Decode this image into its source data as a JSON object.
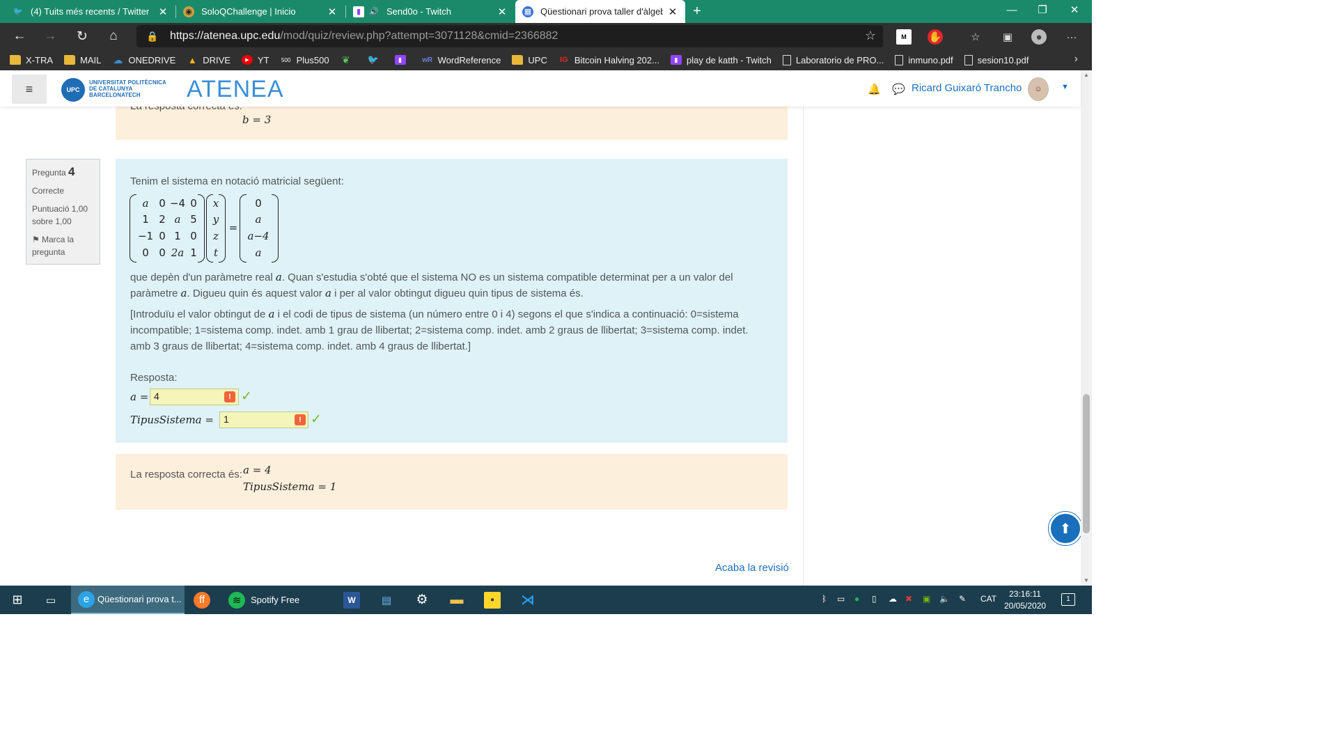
{
  "browser": {
    "tabs": [
      {
        "title": "(4) Tuits més recents / Twitter",
        "icon": "twitter-icon"
      },
      {
        "title": "SoloQChallenge | Inicio",
        "icon": "soloq-icon"
      },
      {
        "title": "Send0o - Twitch",
        "icon": "twitch-icon"
      },
      {
        "title": "Qüestionari prova taller d'àlgebr",
        "icon": "atenea-icon"
      }
    ],
    "url_host": "https://atenea.upc.edu",
    "url_path": "/mod/quiz/review.php?attempt=3071128&cmid=2366882",
    "bookmarks": [
      "X-TRA",
      "MAIL",
      "ONEDRIVE",
      "DRIVE",
      "YT",
      "Plus500",
      "",
      "",
      "",
      "WordReference",
      "UPC",
      "Bitcoin Halving 202...",
      "play de katth - Twitch",
      "Laboratorio de PRO...",
      "inmuno.pdf",
      "sesion10.pdf"
    ]
  },
  "site": {
    "upc_line1": "UNIVERSITAT POLITÈCNICA",
    "upc_line2": "DE CATALUNYA",
    "upc_line3": "BARCELONATECH",
    "upc_badge": "UPC",
    "brand": "ATENEA",
    "user_name": "Ricard Guixaró Trancho"
  },
  "prev_answer": {
    "label": "La resposta correcta és:",
    "line": "b = 3"
  },
  "question": {
    "label": "Pregunta",
    "number": "4",
    "state": "Correcte",
    "score": "Puntuació 1,00 sobre 1,00",
    "flag": "Marca la pregunta",
    "intro": "Tenim el sistema en notació matricial següent:",
    "matrix": [
      [
        "a",
        "0",
        "−4",
        "0"
      ],
      [
        "1",
        "2",
        "a",
        "5"
      ],
      [
        "−1",
        "0",
        "1",
        "0"
      ],
      [
        "0",
        "0",
        "2a",
        "1"
      ]
    ],
    "vars": [
      "x",
      "y",
      "z",
      "t"
    ],
    "rhs": [
      "0",
      "a",
      "a−4",
      "a"
    ],
    "para1_a": "que depèn d'un paràmetre real",
    "para1_b": ". Quan s'estudia s'obté que el sistema NO es un sistema compatible determinat per a un valor del paràmetre",
    "para1_c": ". Digueu quin és aquest valor",
    "para1_d": "i per al valor obtingut digueu quin tipus de sistema és.",
    "para2_a": "[Introduïu el valor obtingut de",
    "para2_b": "i el codi de tipus de sistema (un número entre 0 i 4) segons el que s'indica a continuació: 0=sistema incompatible; 1=sistema comp. indet. amb 1 grau de llibertat; 2=sistema comp. indet. amb 2 graus de llibertat; 3=sistema comp. indet. amb 3 graus de llibertat; 4=sistema comp. indet. amb 4 graus de llibertat.]",
    "answer_label": "Resposta:",
    "field1_label": "a =",
    "field1_value": "4",
    "field2_label": "TipusSistema =",
    "field2_value": "1",
    "correct_label": "La resposta correcta és:",
    "correct_line1": "a = 4",
    "correct_line2": "TipusSistema = 1"
  },
  "finish_review": "Acaba la revisió",
  "taskbar": {
    "edge_label": "Qüestionari prova t...",
    "spotify_label": "Spotify Free",
    "lang": "CAT",
    "time": "23:16:11",
    "date": "20/05/2020",
    "notifications": "1"
  }
}
